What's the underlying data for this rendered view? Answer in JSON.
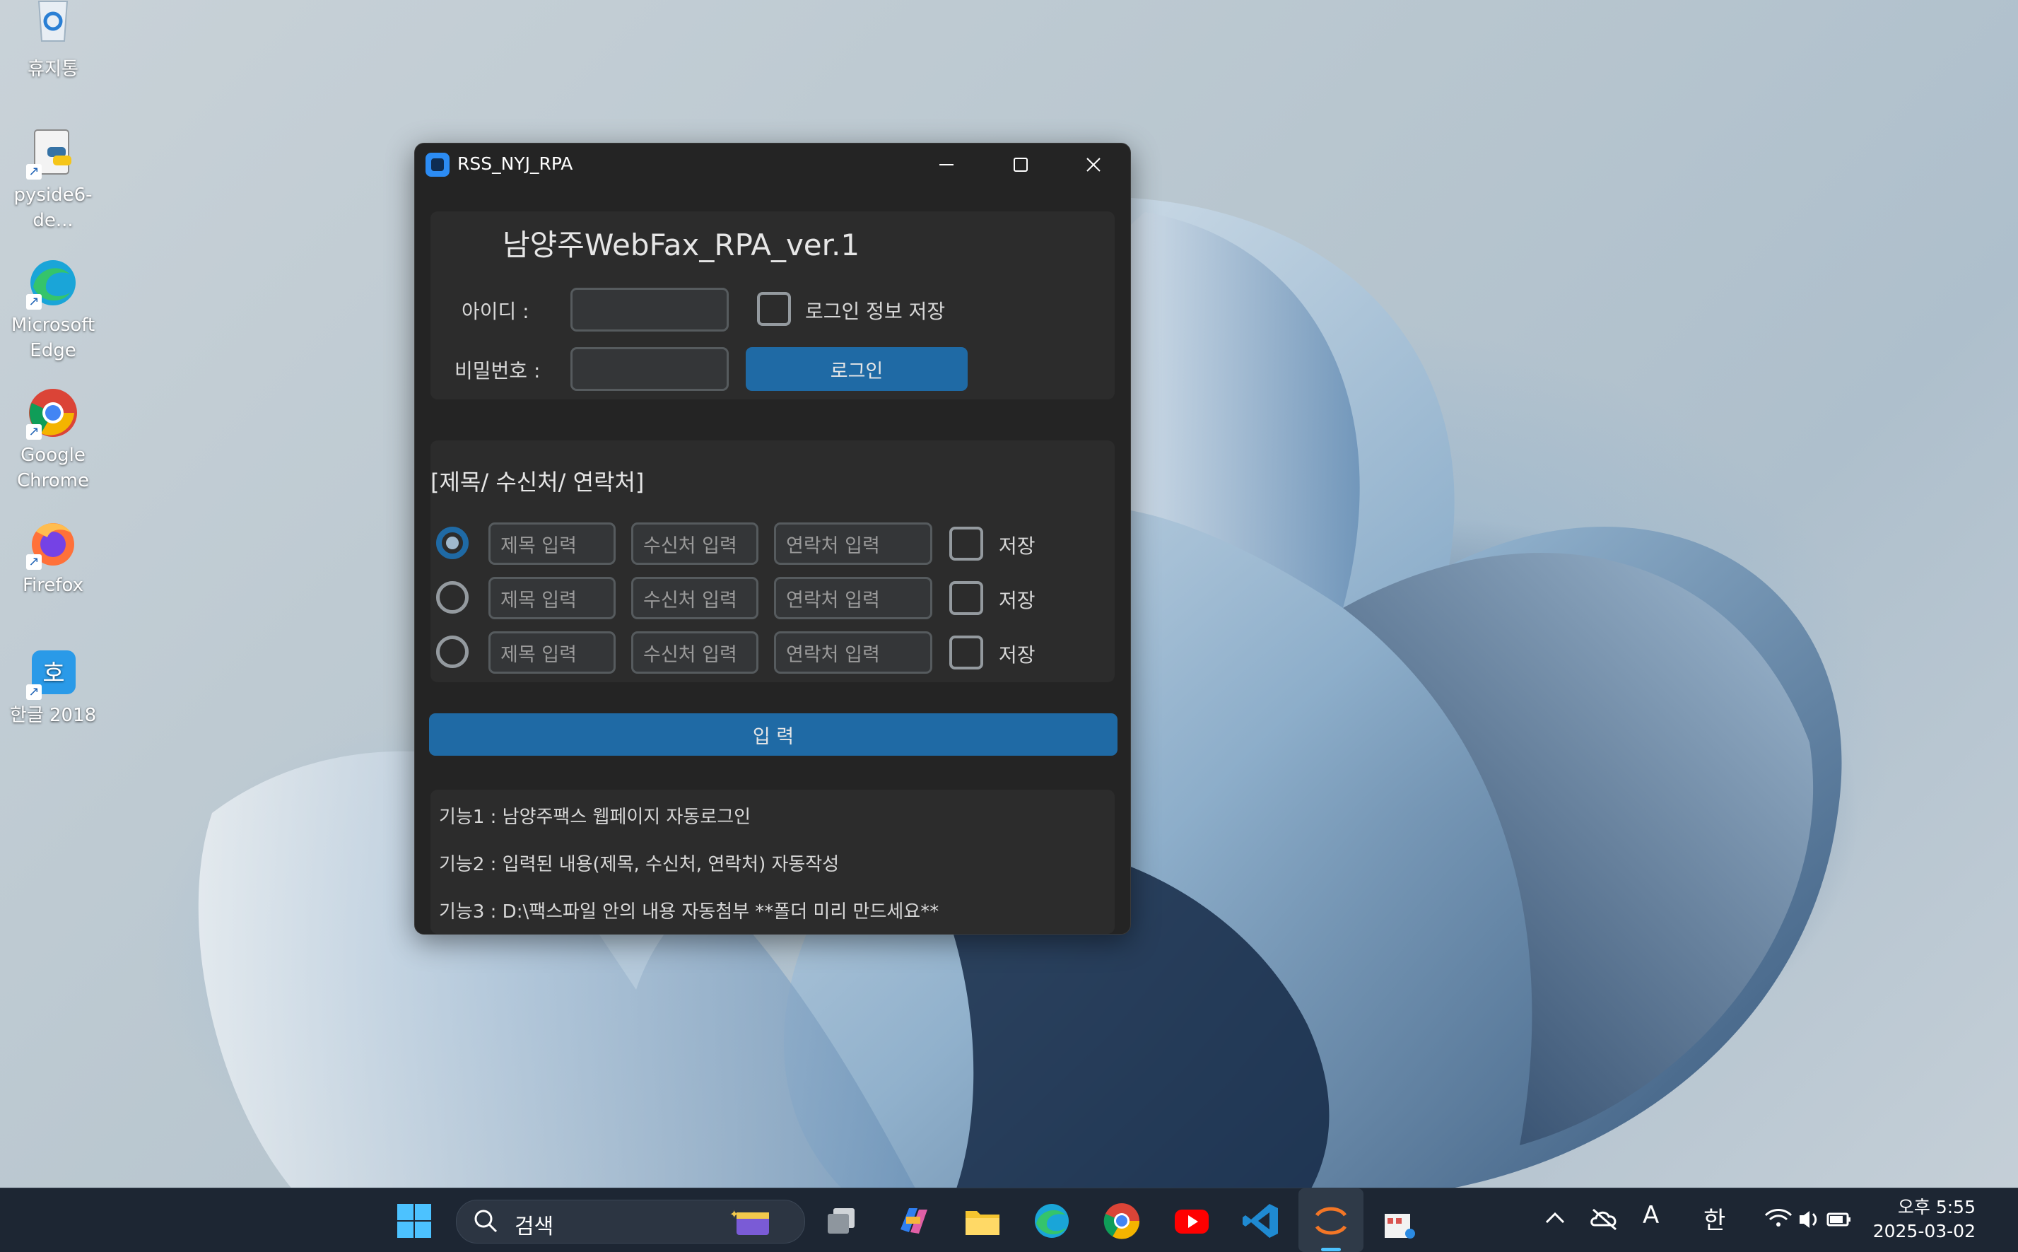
{
  "desktop": {
    "icons": [
      {
        "label": "휴지통",
        "icon": "recycle-bin-icon"
      },
      {
        "label": "pyside6-de...",
        "icon": "python-file-icon"
      },
      {
        "label": "Microsoft Edge",
        "icon": "edge-icon"
      },
      {
        "label": "Google Chrome",
        "icon": "chrome-icon"
      },
      {
        "label": "Firefox",
        "icon": "firefox-icon"
      },
      {
        "label": "한글 2018",
        "icon": "hangul-icon"
      }
    ]
  },
  "window": {
    "title": "RSS_NYJ_RPA",
    "heading": "남양주WebFax_RPA_ver.1",
    "id_label": "아이디 :",
    "pw_label": "비밀번호 :",
    "save_login_label": "로그인 정보 저장",
    "login_button": "로그인",
    "section_title": "[제목/ 수신처/ 연락처]",
    "rows": [
      {
        "selected": true,
        "title_placeholder": "제목 입력",
        "recipient_placeholder": "수신처 입력",
        "contact_placeholder": "연락처 입력",
        "save_label": "저장"
      },
      {
        "selected": false,
        "title_placeholder": "제목 입력",
        "recipient_placeholder": "수신처 입력",
        "contact_placeholder": "연락처 입력",
        "save_label": "저장"
      },
      {
        "selected": false,
        "title_placeholder": "제목 입력",
        "recipient_placeholder": "수신처 입력",
        "contact_placeholder": "연락처 입력",
        "save_label": "저장"
      }
    ],
    "submit_button": "입 력",
    "features": [
      "기능1 : 남양주팩스 웹페이지 자동로그인",
      "기능2 : 입력된 내용(제목, 수신처, 연락처) 자동작성",
      "기능3 : D:\\팩스파일 안의 내용 자동첨부 **폴더 미리 만드세요**"
    ]
  },
  "taskbar": {
    "search_placeholder": "검색",
    "ime_mode": "A",
    "ime_lang": "한",
    "time": "오후 5:55",
    "date": "2025-03-02"
  },
  "colors": {
    "accent": "#1f6aa5",
    "window_bg": "#242424",
    "panel_bg": "#2c2c2c"
  }
}
